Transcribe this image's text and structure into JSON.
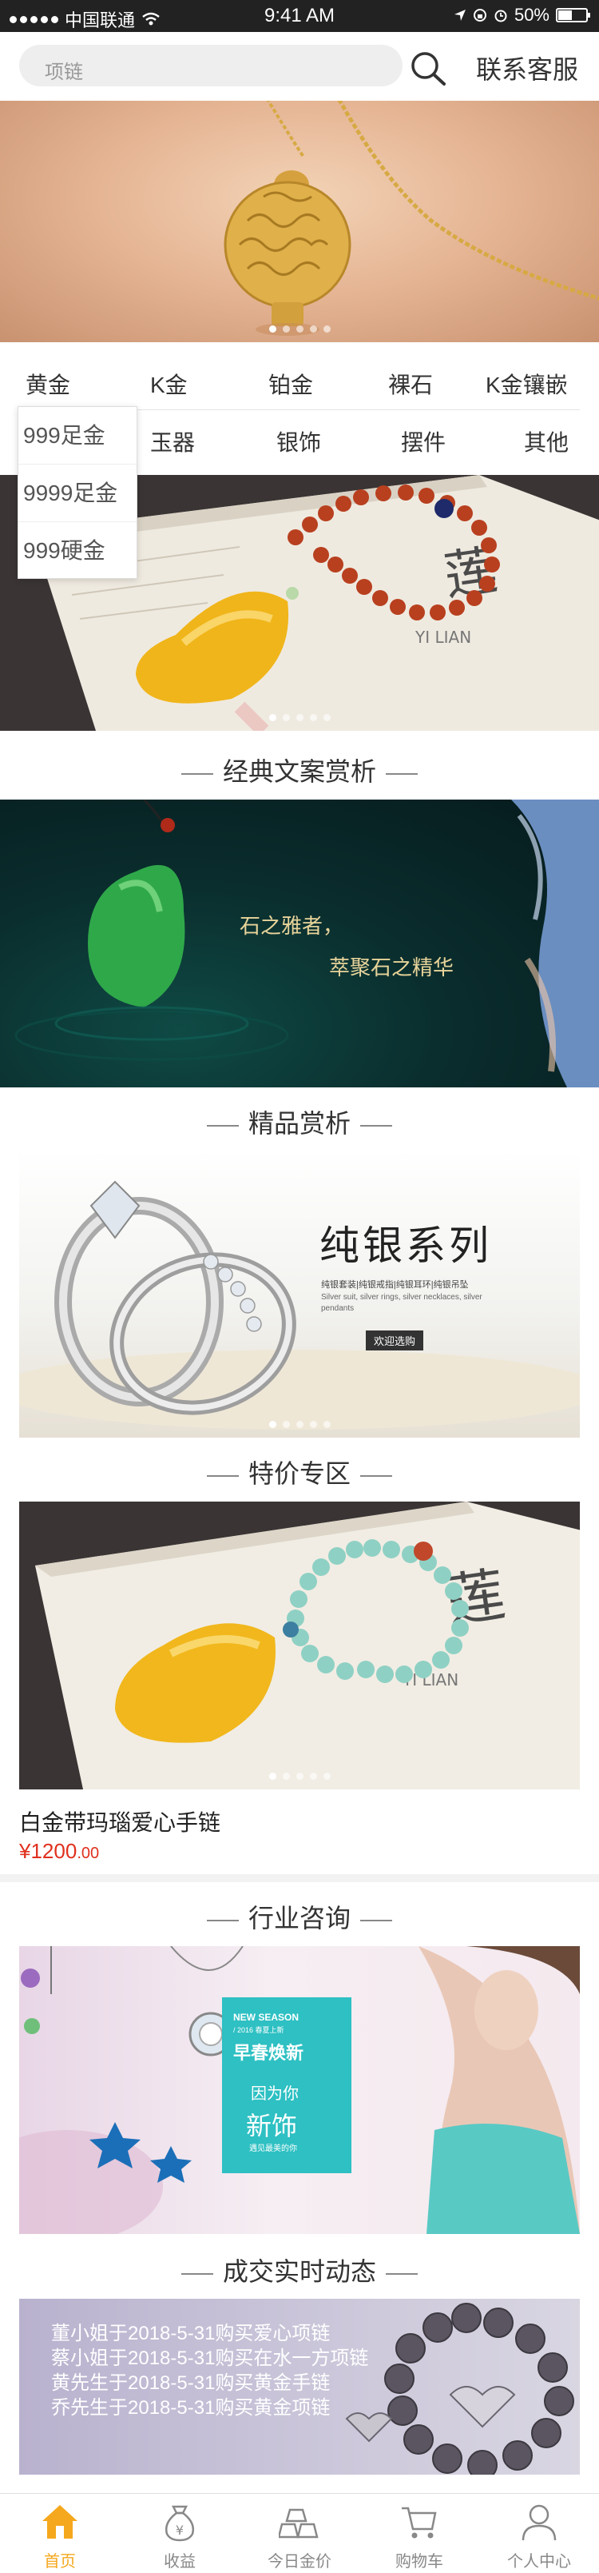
{
  "status_bar": {
    "carrier": "中国联通",
    "time": "9:41 AM",
    "battery": "50%",
    "battery_level": 0.5
  },
  "header": {
    "search_placeholder": "项链",
    "contact_label": "联系客服"
  },
  "categories": {
    "row1": [
      "黄金",
      "K金",
      "铂金",
      "裸石",
      "K金镶嵌"
    ],
    "row2": [
      "玉器",
      "银饰",
      "摆件",
      "其他"
    ]
  },
  "dropdown": [
    "999足金",
    "9999足金",
    "999硬金"
  ],
  "banner2_text": {
    "logo": "莲",
    "sub": "YI LIAN"
  },
  "classic": {
    "title": "经典文案赏析",
    "line1": "石之雅者，",
    "line2": "萃聚石之精华"
  },
  "featured": {
    "title": "精品赏析",
    "headline": "纯银系列",
    "tag": "欢迎选购",
    "desc1": "纯银套装|纯银戒指|纯银耳环|纯银吊坠",
    "desc2": "Silver suit, silver rings, silver necklaces, silver pendants"
  },
  "special": {
    "title": "特价专区",
    "product_name": "白金带玛瑙爱心手链",
    "currency": "¥",
    "price_main": "1200",
    "price_cents": ".00",
    "card_text": "莲 YI LIAN"
  },
  "industry": {
    "title": "行业咨询",
    "season": "NEW SEASON",
    "year": "/ 2016 春夏上新",
    "headline": "早春焕新",
    "because": "因为你",
    "new": "新饰",
    "sub": "遇见最美的你"
  },
  "deals": {
    "title": "成交实时动态",
    "items": [
      "董小姐于2018-5-31购买爱心项链",
      "蔡小姐于2018-5-31购买在水一方项链",
      "黄先生于2018-5-31购买黄金手链",
      "乔先生于2018-5-31购买黄金项链"
    ]
  },
  "tabbar": {
    "items": [
      {
        "label": "首页",
        "icon": "home-icon",
        "active": true
      },
      {
        "label": "收益",
        "icon": "money-bag-icon",
        "active": false
      },
      {
        "label": "今日金价",
        "icon": "gold-bars-icon",
        "active": false
      },
      {
        "label": "购物车",
        "icon": "cart-icon",
        "active": false
      },
      {
        "label": "个人中心",
        "icon": "user-icon",
        "active": false
      }
    ]
  },
  "colors": {
    "accent": "#f5a81d",
    "price": "#e0301e"
  }
}
